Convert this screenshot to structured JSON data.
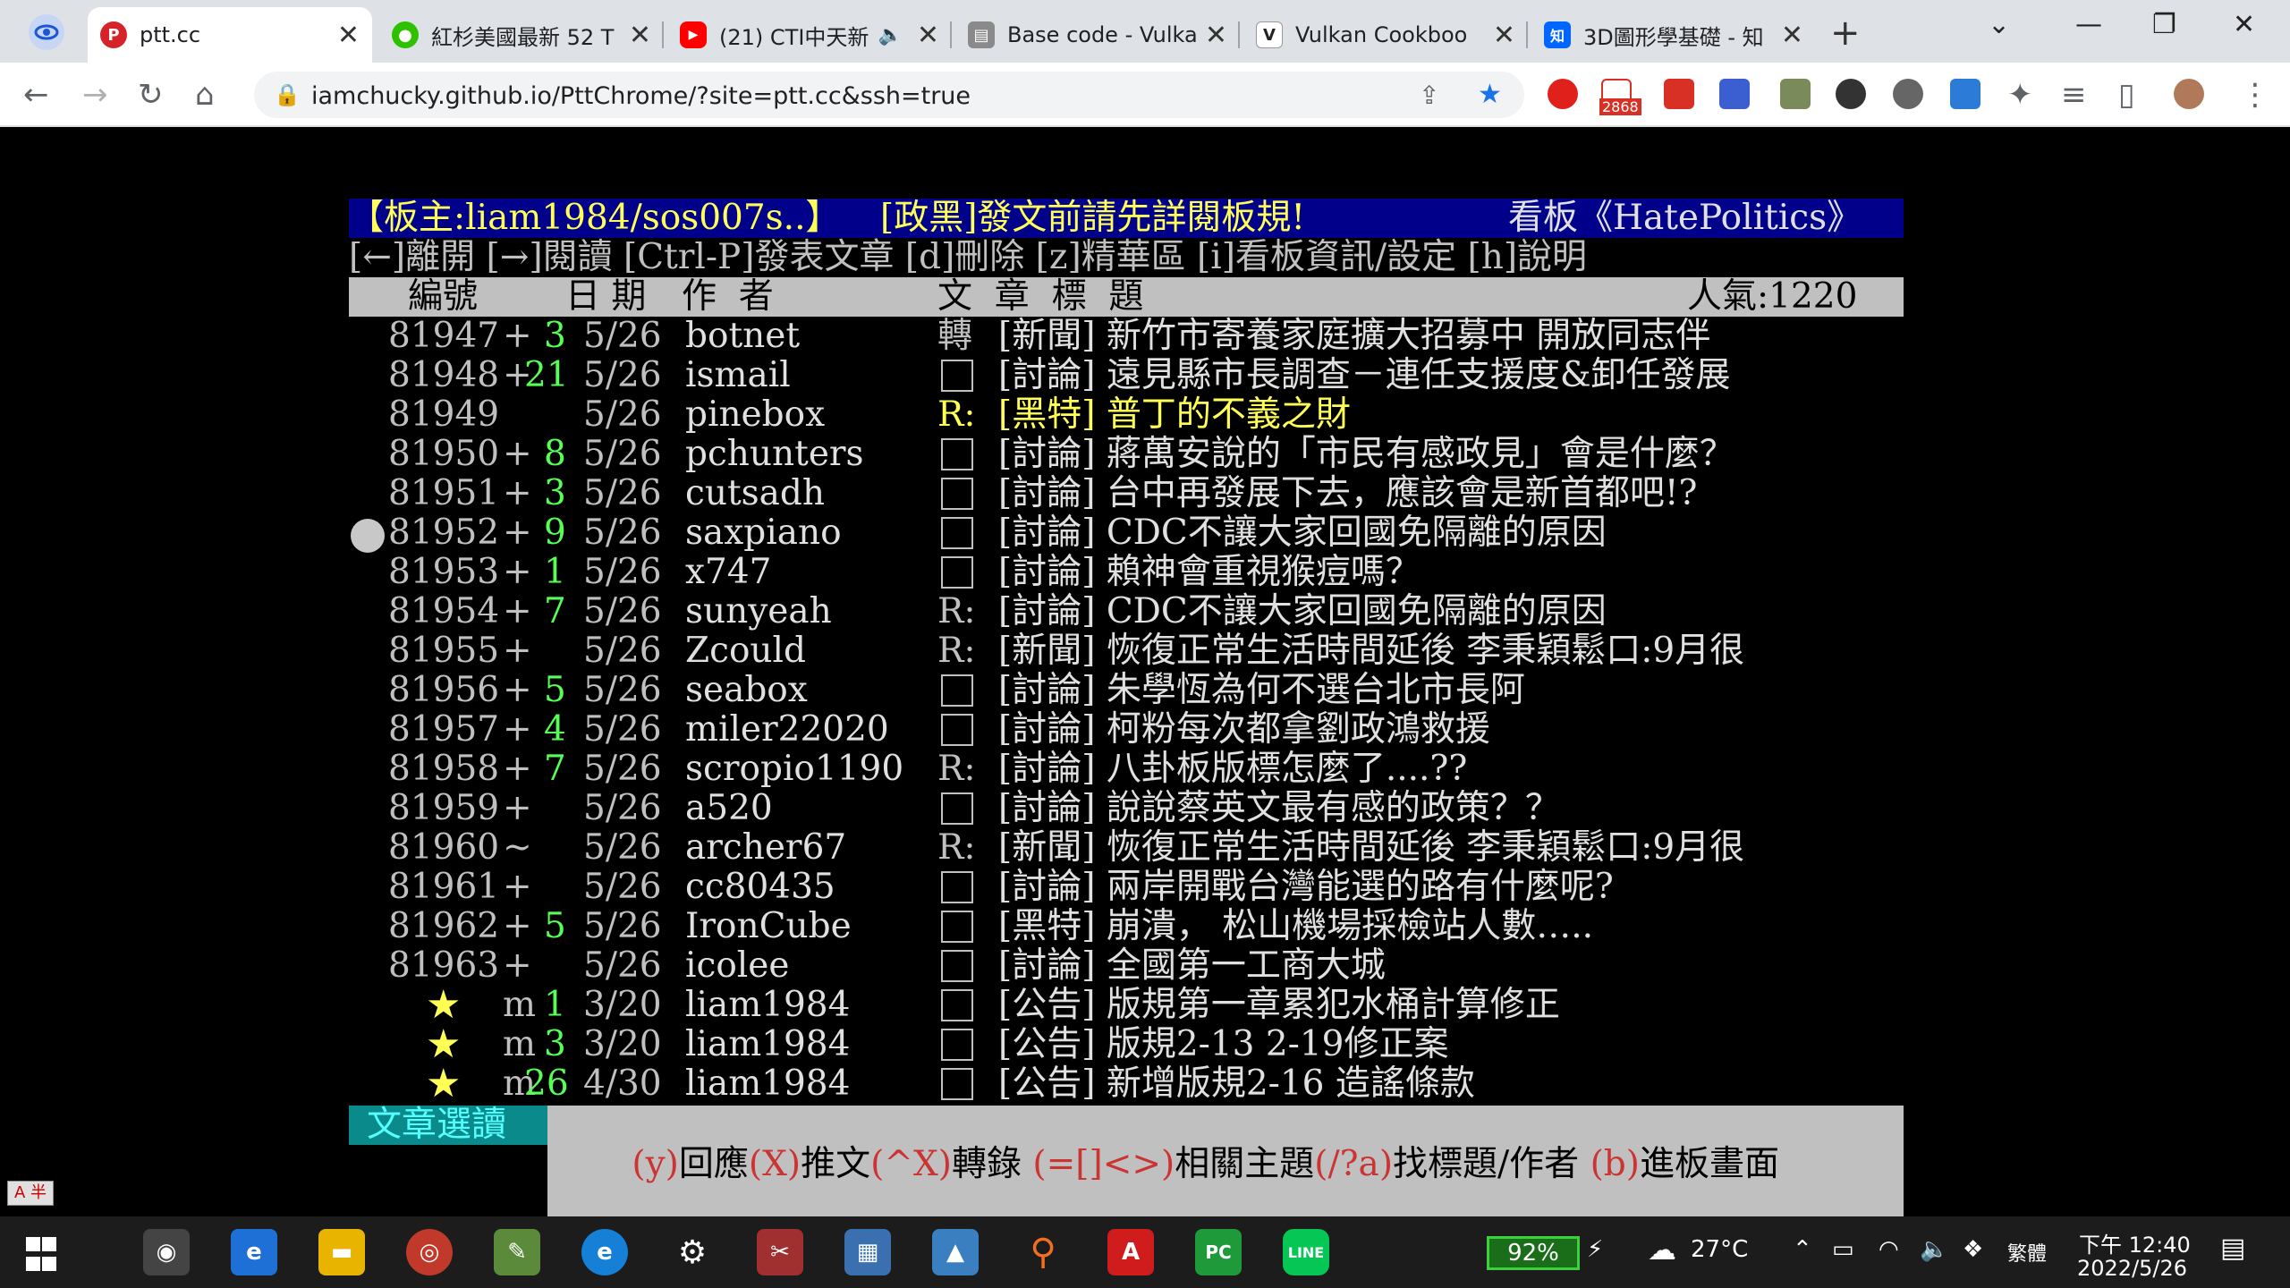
{
  "browser": {
    "tabs": [
      {
        "title": "ptt.cc",
        "favicon": "ptt-icon",
        "active": true
      },
      {
        "title": "紅杉美國最新 52 T",
        "favicon": "wechat-icon",
        "active": false
      },
      {
        "title": "(21) CTI中天新",
        "favicon": "youtube-icon",
        "active": false
      },
      {
        "title": "Base code - Vulka",
        "favicon": "page-icon",
        "active": false
      },
      {
        "title": "Vulkan Cookboo",
        "favicon": "v-icon",
        "active": false
      },
      {
        "title": "3D圖形學基礎 - 知",
        "favicon": "zhihu-icon",
        "active": false
      }
    ],
    "new_tab": "+",
    "url": "iamchucky.github.io/PttChrome/?site=ptt.cc&ssh=true",
    "gmail_badge": "2868"
  },
  "terminal": {
    "header": {
      "moderators": "【板主:liam1984/sos007s..】",
      "notice": "[政黑]發文前請先詳閱板規!",
      "board": "看板《HatePolitics》"
    },
    "help": "[←]離開 [→]閱讀 [Ctrl-P]發表文章 [d]刪除 [z]精華區 [i]看板資訊/設定 [h]說明",
    "columns": {
      "number": "編號",
      "date": "日 期",
      "author": "作  者",
      "title": "文  章  標  題",
      "popularity": "人氣:1220"
    },
    "posts": [
      {
        "num": "81947",
        "mark": "+",
        "push": "3",
        "date": "5/26",
        "author": "botnet",
        "type": "轉",
        "title": "[新聞] 新竹市寄養家庭擴大招募中 開放同志伴"
      },
      {
        "num": "81948",
        "mark": "+",
        "push": "21",
        "date": "5/26",
        "author": "ismail",
        "type": "□",
        "title": "[討論] 遠見縣市長調查－連任支援度&卸任發展"
      },
      {
        "num": "81949",
        "mark": "",
        "push": "",
        "date": "5/26",
        "author": "pinebox",
        "type": "R:",
        "title": "[黑特] 普丁的不義之財"
      },
      {
        "num": "81950",
        "mark": "+",
        "push": "8",
        "date": "5/26",
        "author": "pchunters",
        "type": "□",
        "title": "[討論] 蔣萬安說的「市民有感政見」會是什麼？"
      },
      {
        "num": "81951",
        "mark": "+",
        "push": "3",
        "date": "5/26",
        "author": "cutsadh",
        "type": "□",
        "title": "[討論] 台中再發展下去，應該會是新首都吧!?"
      },
      {
        "num": "81952",
        "mark": "+",
        "push": "9",
        "date": "5/26",
        "author": "saxpiano",
        "type": "□",
        "title": "[討論] CDC不讓大家回國免隔離的原因"
      },
      {
        "num": "81953",
        "mark": "+",
        "push": "1",
        "date": "5/26",
        "author": "x747",
        "type": "□",
        "title": "[討論] 賴神會重視猴痘嗎？"
      },
      {
        "num": "81954",
        "mark": "+",
        "push": "7",
        "date": "5/26",
        "author": "sunyeah",
        "type": "R:",
        "title": "[討論] CDC不讓大家回國免隔離的原因"
      },
      {
        "num": "81955",
        "mark": "+",
        "push": "",
        "date": "5/26",
        "author": "Zcould",
        "type": "R:",
        "title": "[新聞] 恢復正常生活時間延後 李秉穎鬆口:9月很"
      },
      {
        "num": "81956",
        "mark": "+",
        "push": "5",
        "date": "5/26",
        "author": "seabox",
        "type": "□",
        "title": "[討論] 朱學恆為何不選台北市長阿"
      },
      {
        "num": "81957",
        "mark": "+",
        "push": "4",
        "date": "5/26",
        "author": "miler22020",
        "type": "□",
        "title": "[討論] 柯粉每次都拿劉政鴻救援"
      },
      {
        "num": "81958",
        "mark": "+",
        "push": "7",
        "date": "5/26",
        "author": "scropio1190",
        "type": "R:",
        "title": "[討論] 八卦板版標怎麼了....??"
      },
      {
        "num": "81959",
        "mark": "+",
        "push": "",
        "date": "5/26",
        "author": "a520",
        "type": "□",
        "title": "[討論] 說說蔡英文最有感的政策？？"
      },
      {
        "num": "81960",
        "mark": "~",
        "push": "",
        "date": "5/26",
        "author": "archer67",
        "type": "R:",
        "title": "[新聞] 恢復正常生活時間延後 李秉穎鬆口:9月很"
      },
      {
        "num": "81961",
        "mark": "+",
        "push": "",
        "date": "5/26",
        "author": "cc80435",
        "type": "□",
        "title": "[討論] 兩岸開戰台灣能選的路有什麼呢?"
      },
      {
        "num": "81962",
        "mark": "+",
        "push": "5",
        "date": "5/26",
        "author": "IronCube",
        "type": "□",
        "title": "[黑特] 崩潰， 松山機場採檢站人數….."
      },
      {
        "num": "81963",
        "mark": "+",
        "push": "",
        "date": "5/26",
        "author": "icolee",
        "type": "□",
        "title": "[討論] 全國第一工商大城"
      },
      {
        "num": "★",
        "mark": "m",
        "push": "1",
        "date": "3/20",
        "author": "liam1984",
        "type": "□",
        "title": "[公告] 版規第一章累犯水桶計算修正"
      },
      {
        "num": "★",
        "mark": "m",
        "push": "3",
        "date": "3/20",
        "author": "liam1984",
        "type": "□",
        "title": "[公告] 版規2-13 2-19修正案"
      },
      {
        "num": "★",
        "mark": "m",
        "push": "26",
        "date": "4/30",
        "author": "liam1984",
        "type": "□",
        "title": "[公告] 新增版規2-16 造謠條款"
      }
    ],
    "footer": {
      "mode": "文章選讀",
      "k1": "(y)",
      "t1": "回應",
      "k2": "(X)",
      "t2": "推文",
      "k3": "(^X)",
      "t3": "轉錄 ",
      "k4": "(=[]<>)",
      "t4": "相關主題",
      "k5": "(/?a)",
      "t5": "找標題/作者 ",
      "k6": "(b)",
      "t6": "進板畫面"
    }
  },
  "taskbar": {
    "ime": "A 半",
    "battery": "92%",
    "temperature": "27°C",
    "language": "繁體",
    "time": "下午 12:40",
    "date": "2022/5/26"
  }
}
